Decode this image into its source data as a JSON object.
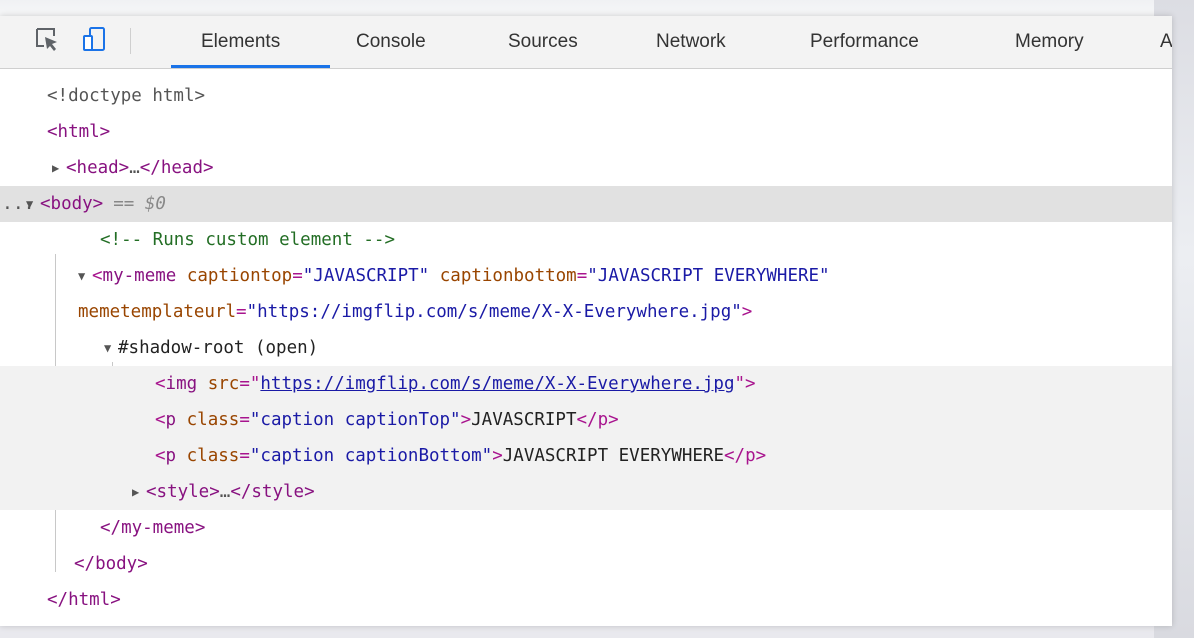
{
  "tabs": [
    "Elements",
    "Console",
    "Sources",
    "Network",
    "Performance",
    "Memory",
    "A"
  ],
  "active_tab": "Elements",
  "colors": {
    "accent": "#1a73e8",
    "tag": "#881280",
    "attr": "#994500",
    "value": "#1a1aa6",
    "comment": "#236e25",
    "selected_row": "#e1e1e1"
  },
  "icons": {
    "inspect": "element-picker-icon",
    "device": "device-toolbar-icon"
  },
  "tree": {
    "doctype": "<!doctype html>",
    "html_open": "<html>",
    "head": {
      "open": "<head>",
      "ellipsis": "…",
      "close": "</head>"
    },
    "body": {
      "open": "<body>",
      "marker": "== $0",
      "ellipsis": "..."
    },
    "comment": "<!-- Runs custom element -->",
    "my_meme": {
      "tag": "my-meme",
      "attr1_name": "captiontop",
      "attr1_value": "\"JAVASCRIPT\"",
      "attr2_name": "captionbottom",
      "attr2_value": "\"JAVASCRIPT EVERYWHERE\"",
      "attr3_name": "memetemplateurl",
      "attr3_value": "\"https://imgflip.com/s/meme/X-X-Everywhere.jpg\""
    },
    "shadow_root": "#shadow-root (open)",
    "img": {
      "tag": "img",
      "attr": "src",
      "url": "https://imgflip.com/s/meme/X-X-Everywhere.jpg"
    },
    "p_top": {
      "tag": "p",
      "attr": "class",
      "value": "\"caption captionTop\"",
      "text": "JAVASCRIPT"
    },
    "p_bottom": {
      "tag": "p",
      "attr": "class",
      "value": "\"caption captionBottom\"",
      "text": "JAVASCRIPT EVERYWHERE"
    },
    "style": {
      "open": "<style>",
      "ellipsis": "…",
      "close": "</style>"
    },
    "my_meme_close": "</my-meme>",
    "body_close": "</body>",
    "html_close": "</html>"
  }
}
